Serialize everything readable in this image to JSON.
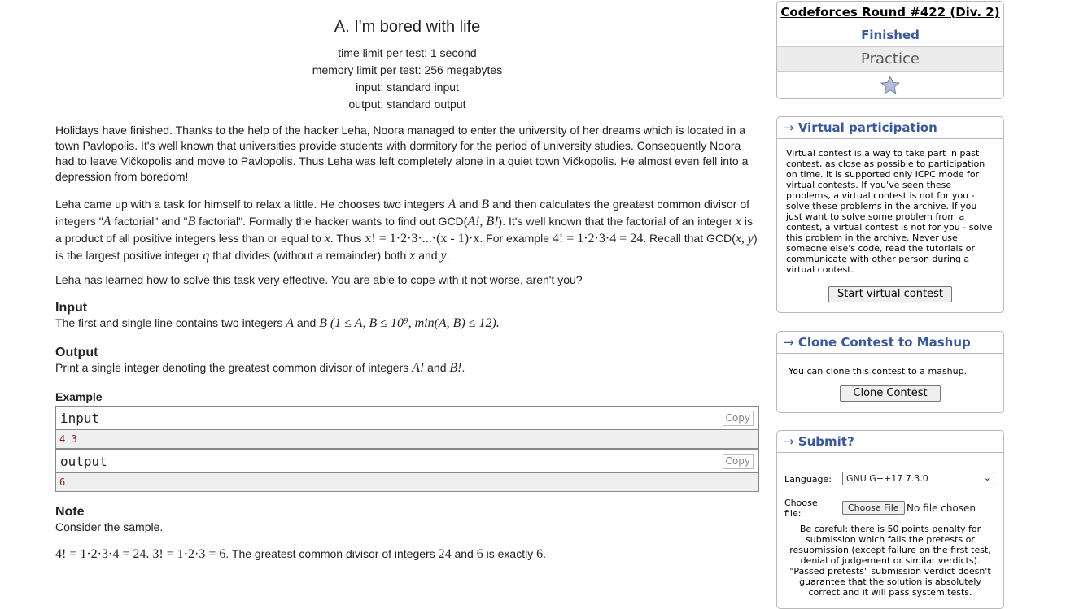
{
  "problem": {
    "title": "A. I'm bored with life",
    "limits": {
      "time": "time limit per test: 1 second",
      "memory": "memory limit per test: 256 megabytes",
      "input": "input: standard input",
      "output": "output: standard output"
    },
    "para1": "Holidays have finished. Thanks to the help of the hacker Leha, Noora managed to enter the university of her dreams which is located in a town Pavlopolis. It's well known that universities provide students with dormitory for the period of university studies. Consequently Noora had to leave Vičkopolis and move to Pavlopolis. Thus Leha was left completely alone in a quiet town Vičkopolis. He almost even fell into a depression from boredom!",
    "para2": {
      "t1": "Leha came up with a task for himself to relax a little. He chooses two integers ",
      "A": "A",
      "t2": " and ",
      "B": "B",
      "t3": " and then calculates the greatest common divisor of integers \"",
      "t4": " factorial\" and \"",
      "t5": " factorial\". Formally the hacker wants to find out GCD(",
      "m1": "A!, B!",
      "t6": "). It's well known that the factorial of an integer ",
      "x": "x",
      "t7": " is a product of all positive integers less than or equal to ",
      "t8": ". Thus ",
      "m2": "x! = 1·2·3·...·(x - 1)·x",
      "t9": ". For example ",
      "m3": "4! = 1·2·3·4 = 24",
      "t10": ". Recall that GCD(",
      "m4": "x, y",
      "t11": ") is the largest positive integer ",
      "q": "q",
      "t12": " that divides (without a remainder) both ",
      "y": "y",
      "t13": "."
    },
    "para3": "Leha has learned how to solve this task very effective. You are able to cope with it not worse, aren't you?",
    "input_title": "Input",
    "input_text": "The first and single line contains two integers ",
    "input_and": " and ",
    "input_math": "(1 ≤ A, B ≤ 10⁹, min(A, B) ≤ 12).",
    "output_title": "Output",
    "output_text": "Print a single integer denoting the greatest common divisor of integers ",
    "output_and": " and ",
    "output_a": "A!",
    "output_b": "B!",
    "output_end": ".",
    "example_title": "Example",
    "examples": [
      {
        "label": "input",
        "copy": "Copy",
        "value": "4 3"
      },
      {
        "label": "output",
        "copy": "Copy",
        "value": "6"
      }
    ],
    "note_title": "Note",
    "note_text": "Consider the sample.",
    "note_m1": "4! = 1·2·3·4 = 24",
    "note_m2": "3! = 1·2·3 = 6",
    "note_t": ". The greatest common divisor of integers ",
    "note_24": "24",
    "note_and": " and ",
    "note_6": "6",
    "note_is": " is exactly ",
    "note_end": "."
  },
  "sidebar": {
    "round_name": "Codeforces Round #422 (Div. 2)",
    "status": "Finished",
    "practice": "Practice",
    "favorite_icon": "star-icon",
    "virtual": {
      "title": "Virtual participation",
      "text": "Virtual contest is a way to take part in past contest, as close as possible to participation on time. It is supported only ICPC mode for virtual contests. If you've seen these problems, a virtual contest is not for you - solve these problems in the archive. If you just want to solve some problem from a contest, a virtual contest is not for you - solve this problem in the archive. Never use someone else's code, read the tutorials or communicate with other person during a virtual contest.",
      "button": "Start virtual contest"
    },
    "clone": {
      "title": "Clone Contest to Mashup",
      "text": "You can clone this contest to a mashup.",
      "button": "Clone Contest"
    },
    "submit": {
      "title": "Submit?",
      "language_label": "Language:",
      "language_value": "GNU G++17 7.3.0",
      "file_label": "Choose file:",
      "file_button": "Choose File",
      "file_status": "No file chosen",
      "warning": "Be careful: there is 50 points penalty for submission which fails the pretests or resubmission (except failure on the first test, denial of judgement or similar verdicts). \"Passed pretests\" submission verdict doesn't guarantee that the solution is absolutely correct and it will pass system tests."
    },
    "caption_arrow": "→"
  },
  "colors": {
    "link_blue": "#3b5998",
    "sample_text": "#8a1d1d",
    "sample_bg": "#efefef"
  }
}
